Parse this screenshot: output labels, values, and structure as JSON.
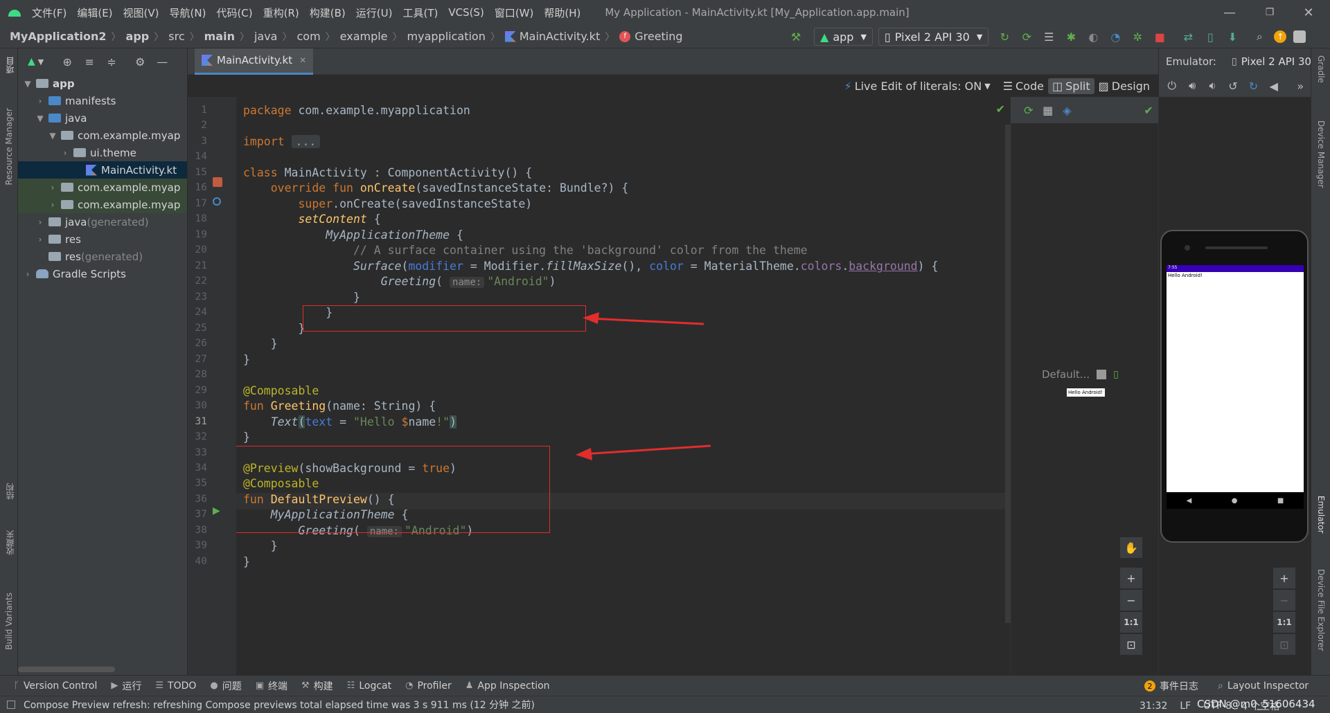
{
  "menu": {
    "items": [
      "文件(F)",
      "编辑(E)",
      "视图(V)",
      "导航(N)",
      "代码(C)",
      "重构(R)",
      "构建(B)",
      "运行(U)",
      "工具(T)",
      "VCS(S)",
      "窗口(W)",
      "帮助(H)"
    ],
    "window_title": "My Application - MainActivity.kt [My_Application.app.main]"
  },
  "breadcrumb": [
    "MyApplication2",
    "app",
    "src",
    "main",
    "java",
    "com",
    "example",
    "myapplication",
    "MainActivity.kt",
    "Greeting"
  ],
  "toolbar": {
    "run_config": "app",
    "device": "Pixel 2 API 30"
  },
  "left_strip": {
    "project": "项目",
    "resource_manager": "Resource Manager",
    "structure": "结构",
    "favorites": "收藏夹",
    "build_variants": "Build Variants"
  },
  "project_tree": [
    {
      "label": "app",
      "indent": 0,
      "arrow": "▼",
      "icon": "folder-gray",
      "bold": true
    },
    {
      "label": "manifests",
      "indent": 1,
      "arrow": "›",
      "icon": "folder-blue"
    },
    {
      "label": "java",
      "indent": 1,
      "arrow": "▼",
      "icon": "folder-blue"
    },
    {
      "label": "com.example.myap",
      "indent": 2,
      "arrow": "▼",
      "icon": "folder-gray"
    },
    {
      "label": "ui.theme",
      "indent": 3,
      "arrow": "›",
      "icon": "folder-gray"
    },
    {
      "label": "MainActivity.kt",
      "indent": 4,
      "arrow": "",
      "icon": "kotlin",
      "selected": true
    },
    {
      "label": "com.example.myap",
      "indent": 2,
      "arrow": "›",
      "icon": "folder-gray",
      "green": true
    },
    {
      "label": "com.example.myap",
      "indent": 2,
      "arrow": "›",
      "icon": "folder-gray",
      "green": true
    },
    {
      "label": "java",
      "suffix": " (generated)",
      "indent": 1,
      "arrow": "›",
      "icon": "folder-gray"
    },
    {
      "label": "res",
      "indent": 1,
      "arrow": "›",
      "icon": "folder-gray"
    },
    {
      "label": "res",
      "suffix": " (generated)",
      "indent": 1,
      "arrow": "",
      "icon": "folder-gray"
    },
    {
      "label": "Gradle Scripts",
      "indent": 0,
      "arrow": "›",
      "icon": "gradle"
    }
  ],
  "editor": {
    "tab_label": "MainActivity.kt",
    "live_edit": "Live Edit of literals: ON",
    "view_modes": {
      "code": "Code",
      "split": "Split",
      "design": "Design"
    },
    "line_numbers": [
      "1",
      "2",
      "3",
      "14",
      "15",
      "16",
      "17",
      "18",
      "19",
      "20",
      "21",
      "22",
      "23",
      "24",
      "25",
      "26",
      "27",
      "28",
      "29",
      "30",
      "31",
      "32",
      "33",
      "34",
      "35",
      "36",
      "37",
      "38",
      "39",
      "40"
    ],
    "current_line": "31"
  },
  "preview": {
    "default_label": "Default...",
    "hello_chip": "Hello Android!",
    "zoom_one": "1:1"
  },
  "emulator": {
    "label": "Emulator:",
    "device_tab": "Pixel 2 API 30",
    "screen_text": "Hello Android!",
    "status_time": "7:55",
    "zoom_one": "1:1"
  },
  "right_strip": {
    "gradle": "Gradle",
    "device_manager": "Device Manager",
    "emulator": "Emulator",
    "file_explorer": "Device File Explorer"
  },
  "bottom_tools": [
    {
      "label": "Version Control",
      "icon": "ᚴ"
    },
    {
      "label": "运行",
      "icon": "▶"
    },
    {
      "label": "TODO",
      "icon": "☰"
    },
    {
      "label": "问题",
      "icon": "●"
    },
    {
      "label": "终端",
      "icon": "▣"
    },
    {
      "label": "构建",
      "icon": "⚒"
    },
    {
      "label": "Logcat",
      "icon": "☷"
    },
    {
      "label": "Profiler",
      "icon": "◔"
    },
    {
      "label": "App Inspection",
      "icon": "♟"
    }
  ],
  "bottom_right": {
    "event_count": "2",
    "event_log": "事件日志",
    "layout_inspector": "Layout Inspector"
  },
  "status": {
    "message": "Compose Preview refresh: refreshing Compose previews total elapsed time was 3 s 911 ms (12 分钟 之前)",
    "position": "31:32",
    "line_sep": "LF",
    "encoding": "UTF-8",
    "indent": "4 个空格",
    "watermark": "CSDN @m0_51606434"
  },
  "colors": {
    "accent": "#4a88c7",
    "annotation_box": "#e22d2d",
    "android_green": "#3ddc84"
  }
}
